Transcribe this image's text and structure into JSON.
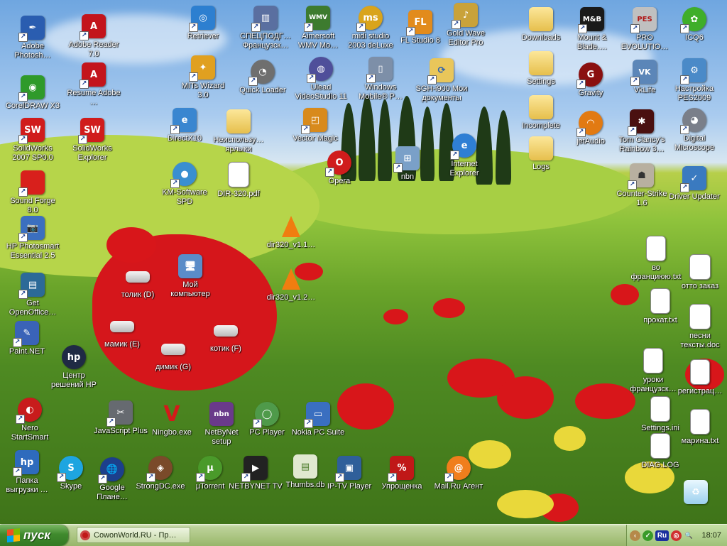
{
  "desktop": {
    "icons": [
      {
        "label": "Adobe Photosh…",
        "icon": "photoshop-feather-icon",
        "color": "#2a5db0",
        "glyph": "✒",
        "shortcut": true
      },
      {
        "label": "CorelDRAW X3",
        "icon": "coreldraw-icon",
        "color": "#2f9a2a",
        "glyph": "◉",
        "shortcut": true
      },
      {
        "label": "SolidWorks 2007 SP0.0",
        "icon": "solidworks-icon",
        "color": "#d01c1c",
        "glyph": "SW",
        "shortcut": true
      },
      {
        "label": "Sound Forge 8.0",
        "icon": "sound-forge-icon",
        "color": "#d8201c",
        "glyph": "",
        "shortcut": true
      },
      {
        "label": "HP Photosmart Essential 2.5",
        "icon": "hp-photosmart-icon",
        "color": "#3b6fbf",
        "glyph": "📷",
        "shortcut": true
      },
      {
        "label": "Get OpenOffice…",
        "icon": "openoffice-icon",
        "color": "#2c6a98",
        "glyph": "▤",
        "shortcut": true
      },
      {
        "label": "Paint.NET",
        "icon": "paint-net-icon",
        "color": "#3a63b8",
        "glyph": "✎",
        "shortcut": true
      },
      {
        "label": "Nero StartSmart",
        "icon": "nero-icon",
        "color": "#c81c1c",
        "glyph": "◐",
        "shortcut": true
      },
      {
        "label": "Папка выгрузки …",
        "icon": "hp-folder-icon",
        "color": "#2e6bbd",
        "glyph": "hp",
        "shortcut": true
      },
      {
        "label": "Adobe Reader 7.0",
        "icon": "adobe-reader-icon",
        "color": "#c3141c",
        "glyph": "A",
        "shortcut": true
      },
      {
        "label": "Resume Adobe …",
        "icon": "adobe-resume-icon",
        "color": "#c3141c",
        "glyph": "A",
        "shortcut": true
      },
      {
        "label": "SolidWorks Explorer",
        "icon": "solidworks-explorer-icon",
        "color": "#d01c1c",
        "glyph": "SW",
        "shortcut": true
      },
      {
        "label": "Центр решений HP",
        "icon": "hp-solution-center-icon",
        "color": "#1f2a44",
        "glyph": "hp",
        "shortcut": false
      },
      {
        "label": "Skype",
        "icon": "skype-icon",
        "color": "#1ea5e0",
        "glyph": "S",
        "shortcut": true
      },
      {
        "label": "Retriever",
        "icon": "retriever-icon",
        "color": "#2d7fd0",
        "glyph": "◎",
        "shortcut": true
      },
      {
        "label": "MITs Wizard 3.0",
        "icon": "mits-wizard-icon",
        "color": "#e0a020",
        "glyph": "✦",
        "shortcut": true
      },
      {
        "label": "DirectX10",
        "icon": "directx-icon",
        "color": "#3a86d0",
        "glyph": "e",
        "shortcut": true
      },
      {
        "label": "KM-Software SPD",
        "icon": "km-software-icon",
        "color": "#3a8fd0",
        "glyph": "●",
        "shortcut": true
      },
      {
        "label": "JavaScript Plus",
        "icon": "javascript-plus-icon",
        "color": "#666a70",
        "glyph": "✂",
        "shortcut": true
      },
      {
        "label": "Google Плане…",
        "icon": "google-earth-icon",
        "color": "#1c3f8c",
        "glyph": "🌐",
        "shortcut": true
      },
      {
        "label": "СПЕЦПОДГ… Французск…",
        "icon": "audio-editor-icon",
        "color": "#5a6fa0",
        "glyph": "▥",
        "shortcut": true
      },
      {
        "label": "Quick Loader",
        "icon": "quick-loader-icon",
        "color": "#6f6f6f",
        "glyph": "◔",
        "shortcut": true
      },
      {
        "label": "Неиспользу… ярлыки",
        "icon": "folder-icon",
        "color": "#e9c65a",
        "glyph": "",
        "shortcut": false,
        "type": "folder"
      },
      {
        "label": "DIR-320.pdf",
        "icon": "pdf-file-icon",
        "color": "#ffffff",
        "glyph": "PDF",
        "shortcut": false,
        "type": "pdf"
      },
      {
        "label": "Aimersoft WMV Mo…",
        "icon": "aimersoft-icon",
        "color": "#3d7b2f",
        "glyph": "WMV",
        "shortcut": true
      },
      {
        "label": "Ulead VideoStudio 11",
        "icon": "ulead-icon",
        "color": "#4f4f9a",
        "glyph": "◍",
        "shortcut": true
      },
      {
        "label": "Vector Magic",
        "icon": "vector-magic-icon",
        "color": "#d88a1c",
        "glyph": "◰",
        "shortcut": true
      },
      {
        "label": "midi studio 2003 deLuxe",
        "icon": "midi-studio-icon",
        "color": "#d9a41c",
        "glyph": "ms",
        "shortcut": true
      },
      {
        "label": "Windows Mobile® P…",
        "icon": "windows-mobile-icon",
        "color": "#7d8fa8",
        "glyph": "▯",
        "shortcut": true
      },
      {
        "label": "Opera",
        "icon": "opera-icon",
        "color": "#d01c1c",
        "glyph": "O",
        "shortcut": true
      },
      {
        "label": "nbn",
        "icon": "network-icon",
        "color": "#7aa0c8",
        "glyph": "⊞",
        "shortcut": true
      },
      {
        "label": "FL Studio 8",
        "icon": "fl-studio-icon",
        "color": "#e28b1c",
        "glyph": "FL",
        "shortcut": true
      },
      {
        "label": "SGH-i900 Мои документы",
        "icon": "sgh-folder-icon",
        "color": "#e9c65a",
        "glyph": "⟳",
        "shortcut": true
      },
      {
        "label": "Internet Explorer",
        "icon": "internet-explorer-icon",
        "color": "#2f7fd4",
        "glyph": "e",
        "shortcut": true
      },
      {
        "label": "Gold Wave Editor Pro",
        "icon": "goldwave-icon",
        "color": "#c9a23a",
        "glyph": "♪",
        "shortcut": true
      },
      {
        "label": "Downloads",
        "icon": "folder-icon",
        "color": "#e9c65a",
        "glyph": "",
        "shortcut": false,
        "type": "folder"
      },
      {
        "label": "Settings",
        "icon": "folder-icon",
        "color": "#e9c65a",
        "glyph": "",
        "shortcut": false,
        "type": "folder"
      },
      {
        "label": "Incomplete",
        "icon": "folder-icon",
        "color": "#e9c65a",
        "glyph": "",
        "shortcut": false,
        "type": "folder"
      },
      {
        "label": "Logs",
        "icon": "folder-icon",
        "color": "#e9c65a",
        "glyph": "",
        "shortcut": false,
        "type": "folder"
      },
      {
        "label": "Mount & Blade.…",
        "icon": "mount-blade-icon",
        "color": "#1a1a1a",
        "glyph": "M&B",
        "shortcut": true
      },
      {
        "label": "Gravity",
        "icon": "gravity-icon",
        "color": "#8a1010",
        "glyph": "G",
        "shortcut": true
      },
      {
        "label": "jetAudio",
        "icon": "jetaudio-icon",
        "color": "#e27a12",
        "glyph": "◠",
        "shortcut": true
      },
      {
        "label": "Tom Clancy's Rainbow 3…",
        "icon": "rainbow-six-icon",
        "color": "#4a1010",
        "glyph": "✱",
        "shortcut": true
      },
      {
        "label": "Counter-Strike 1.6",
        "icon": "counter-strike-icon",
        "color": "#b8b0a0",
        "glyph": "☗",
        "shortcut": true
      },
      {
        "label": "PRO EVOLUTIO…",
        "icon": "pro-evolution-icon",
        "color": "#c0c0c0",
        "glyph": "PES",
        "shortcut": true
      },
      {
        "label": "VkLife",
        "icon": "vklife-icon",
        "color": "#5b86b8",
        "glyph": "VK",
        "shortcut": true
      },
      {
        "label": "ICQ6",
        "icon": "icq-icon",
        "color": "#3fae2a",
        "glyph": "✿",
        "shortcut": true
      },
      {
        "label": "Настройка PES2009",
        "icon": "pes-settings-icon",
        "color": "#4a8ac8",
        "glyph": "⚙",
        "shortcut": true
      },
      {
        "label": "Digital Microscope",
        "icon": "digital-microscope-icon",
        "color": "#7a7f8a",
        "glyph": "◕",
        "shortcut": true
      },
      {
        "label": "Driver Updater",
        "icon": "driver-updater-icon",
        "color": "#3a7ac0",
        "glyph": "✓",
        "shortcut": true
      },
      {
        "label": "Мой компьютер",
        "icon": "my-computer-icon",
        "color": "#5a8cc8",
        "glyph": "🖥",
        "shortcut": false
      },
      {
        "label": "толик (D)",
        "icon": "drive-icon",
        "color": "#e0e0e0",
        "glyph": "",
        "shortcut": false,
        "type": "drive"
      },
      {
        "label": "мамик (E)",
        "icon": "drive-icon",
        "color": "#e0e0e0",
        "glyph": "",
        "shortcut": false,
        "type": "drive"
      },
      {
        "label": "котик (F)",
        "icon": "drive-icon",
        "color": "#e0e0e0",
        "glyph": "",
        "shortcut": false,
        "type": "drive"
      },
      {
        "label": "димик (G)",
        "icon": "drive-icon",
        "color": "#e0e0e0",
        "glyph": "",
        "shortcut": false,
        "type": "drive"
      },
      {
        "label": "dir320_v1.1…",
        "icon": "vlc-cone-icon",
        "color": "#f07d10",
        "glyph": "",
        "shortcut": false,
        "type": "cone"
      },
      {
        "label": "dir320_v1.2…",
        "icon": "vlc-cone-icon",
        "color": "#f07d10",
        "glyph": "",
        "shortcut": false,
        "type": "cone"
      },
      {
        "label": "Ningbo.exe",
        "icon": "ningbo-icon",
        "color": "#d41a1a",
        "glyph": "V",
        "shortcut": false
      },
      {
        "label": "NetByNet setup",
        "icon": "netbynet-icon",
        "color": "#6a3a8a",
        "glyph": "nbn",
        "shortcut": false
      },
      {
        "label": "PC Player",
        "icon": "pc-player-icon",
        "color": "#4f9a4a",
        "glyph": "◯",
        "shortcut": true
      },
      {
        "label": "Nokia PC Suite",
        "icon": "nokia-pc-suite-icon",
        "color": "#3a6fc0",
        "glyph": "▭",
        "shortcut": true
      },
      {
        "label": "StrongDC.exe",
        "icon": "strongdc-icon",
        "color": "#7a4a2a",
        "glyph": "◈",
        "shortcut": true
      },
      {
        "label": "µTorrent",
        "icon": "utorrent-icon",
        "color": "#4a9a2a",
        "glyph": "µ",
        "shortcut": true
      },
      {
        "label": "NETBYNET TV",
        "icon": "netbynet-tv-icon",
        "color": "#222222",
        "glyph": "▶",
        "shortcut": true
      },
      {
        "label": "Thumbs.db",
        "icon": "thumbs-db-icon",
        "color": "#e0e8d0",
        "glyph": "▤",
        "shortcut": false
      },
      {
        "label": "IP-TV Player",
        "icon": "iptv-player-icon",
        "color": "#2f5f9a",
        "glyph": "▣",
        "shortcut": true
      },
      {
        "label": "Упрощенка",
        "icon": "uproshchenka-icon",
        "color": "#c01818",
        "glyph": "%",
        "shortcut": true
      },
      {
        "label": "Mail.Ru Агент",
        "icon": "mail-ru-agent-icon",
        "color": "#f07e1c",
        "glyph": "@",
        "shortcut": true
      },
      {
        "label": "во франциюю.txt",
        "icon": "text-file-icon",
        "color": "#ffffff",
        "glyph": "≡",
        "shortcut": false,
        "type": "doc"
      },
      {
        "label": "прокат.txt",
        "icon": "text-file-icon",
        "color": "#ffffff",
        "glyph": "≡",
        "shortcut": false,
        "type": "doc"
      },
      {
        "label": "уроки французск…",
        "icon": "text-file-icon",
        "color": "#ffffff",
        "glyph": "≡",
        "shortcut": false,
        "type": "doc"
      },
      {
        "label": "Settings.ini",
        "icon": "ini-file-icon",
        "color": "#ffffff",
        "glyph": "⚙",
        "shortcut": false,
        "type": "doc"
      },
      {
        "label": "DIAG.LOG",
        "icon": "text-file-icon",
        "color": "#ffffff",
        "glyph": "≡",
        "shortcut": false,
        "type": "doc"
      },
      {
        "label": "отто заказ",
        "icon": "word-doc-icon",
        "color": "#ffffff",
        "glyph": "W",
        "shortcut": false,
        "type": "word"
      },
      {
        "label": "песни тексты.doc",
        "icon": "word-doc-icon",
        "color": "#ffffff",
        "glyph": "W",
        "shortcut": false,
        "type": "word"
      },
      {
        "label": "регистрац…",
        "icon": "text-file-icon",
        "color": "#ffffff",
        "glyph": "≡",
        "shortcut": false,
        "type": "doc"
      },
      {
        "label": "марина.txt",
        "icon": "text-file-icon",
        "color": "#ffffff",
        "glyph": "≡",
        "shortcut": false,
        "type": "doc"
      },
      {
        "label": "",
        "icon": "recycle-bin-icon",
        "color": "#9cd0ee",
        "glyph": "♻",
        "shortcut": false,
        "type": "recycle"
      }
    ]
  },
  "taskbar": {
    "start_label": "пуск",
    "start_logo_colors": [
      "#f25022",
      "#7fba00",
      "#00a4ef",
      "#ffb900"
    ],
    "windows": [
      {
        "title": "CowonWorld.RU - Пр…",
        "icon": "opera-icon"
      }
    ],
    "tray": {
      "icons": [
        "chevron-left-icon",
        "check-shield-icon",
        "language-indicator-icon",
        "spiral-app-icon",
        "search-tray-icon"
      ],
      "language": "Ru",
      "clock": "18:07"
    }
  }
}
